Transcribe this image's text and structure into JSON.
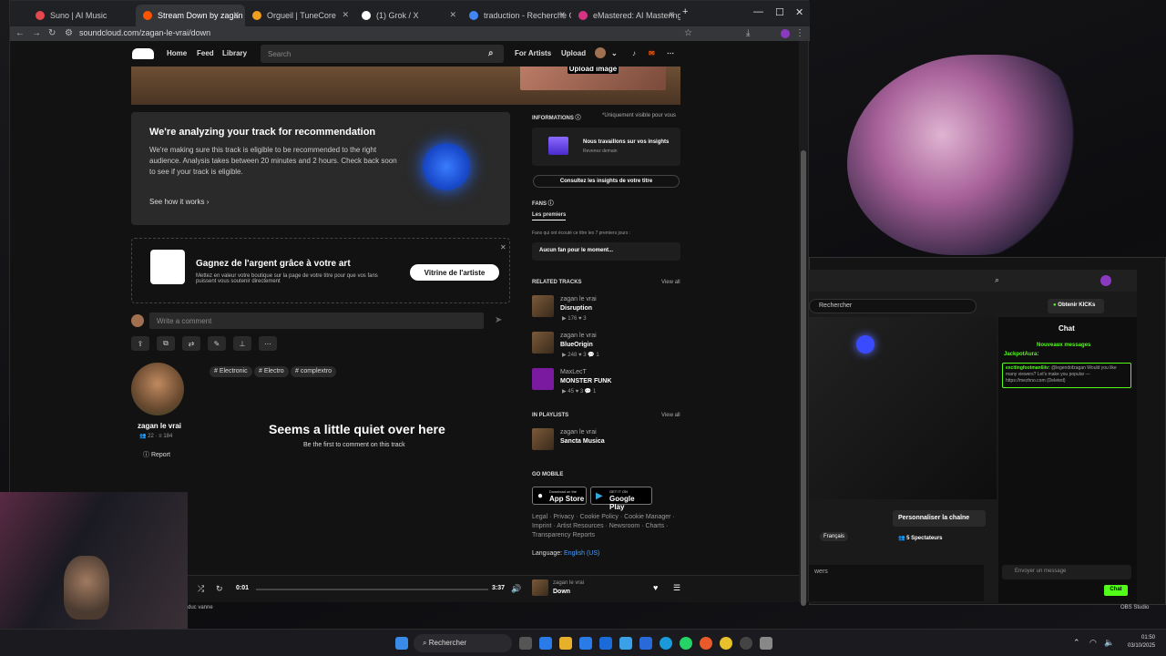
{
  "tabs": [
    {
      "label": "Suno | AI Music",
      "color": "#e5484d"
    },
    {
      "label": "Stream Down by zagan le vrai",
      "color": "#ff5500",
      "active": true
    },
    {
      "label": "Orgueil | TuneCore",
      "color": "#f0a020"
    },
    {
      "label": "(1) Grok / X",
      "color": "#ffffff"
    },
    {
      "label": "traduction - Recherche Google",
      "color": "#4285f4"
    },
    {
      "label": "eMastered: AI Mastering & Onl",
      "color": "#d63384"
    }
  ],
  "address": "soundcloud.com/zagan-le-vrai/down",
  "nav": {
    "home": "Home",
    "feed": "Feed",
    "library": "Library",
    "search_placeholder": "Search",
    "for_artists": "For Artists",
    "upload": "Upload",
    "upload_image": "Upload image"
  },
  "analyze": {
    "title": "We're analyzing your track for recommendation",
    "body": "We're making sure this track is eligible to be recommended to the right audience. Analysis takes between 20 minutes and 2 hours. Check back soon to see if your track is eligible.",
    "link": "See how it works"
  },
  "promo": {
    "title": "Gagnez de l'argent grâce à votre art",
    "body": "Mettez en valeur votre boutique sur la page de votre titre pour que vos fans puissent vous soutenir directement",
    "button": "Vitrine de l'artiste"
  },
  "comment_placeholder": "Write a comment",
  "tags": [
    "# Electronic",
    "# Electro",
    "# complextro"
  ],
  "artist": {
    "name": "zagan le vrai",
    "followers": "22",
    "tracks": "184",
    "report": "Report"
  },
  "empty": {
    "title": "Seems a little quiet over here",
    "sub": "Be the first to comment on this track"
  },
  "info": {
    "heading": "INFORMATIONS",
    "note": "*Uniquement visible pour vous",
    "insight_title": "Nous travaillons sur vos insights",
    "insight_sub": "Revenez demain",
    "insight_btn": "Consultez les insights de votre titre",
    "fans": "FANS",
    "fans_tab": "Les premiers",
    "fans_desc": "Fans qui ont écouté ce titre les 7 premiers jours :",
    "fans_empty": "Aucun fan pour le moment..."
  },
  "related": {
    "heading": "RELATED TRACKS",
    "view_all": "View all",
    "items": [
      {
        "artist": "zagan le vrai",
        "title": "Disruption",
        "stats": "▶ 176  ♥ 3"
      },
      {
        "artist": "zagan le vrai",
        "title": "BlueOrigin",
        "stats": "▶ 248  ♥ 3  💬 1"
      },
      {
        "artist": "MaxLecT",
        "title": "MONSTER FUNK",
        "stats": "▶ 45  ♥ 3  💬 1"
      }
    ]
  },
  "playlists": {
    "heading": "IN PLAYLISTS",
    "view_all": "View all",
    "artist": "zagan le vrai",
    "title": "Sancta Musica"
  },
  "mobile": {
    "heading": "GO MOBILE",
    "appstore": "App Store",
    "appstore_small": "Download on the",
    "gplay": "Google Play",
    "gplay_small": "GET IT ON"
  },
  "footer": {
    "links1": "Legal · Privacy · Cookie Policy · Cookie Manager ·",
    "links2": "Imprint · Artist Resources · Newsroom · Charts ·",
    "links3": "Transparency Reports",
    "language_label": "Language:",
    "language": "English (US)"
  },
  "player": {
    "elapsed": "0:01",
    "duration": "3:37",
    "artist": "zagan le vrai",
    "title": "Down"
  },
  "kick": {
    "search": "Rechercher",
    "get_kicks": "Obtenir KICKs",
    "chat_title": "Chat",
    "new_messages": "Nouveaux messages",
    "user1": "JackpotAura:",
    "user2": "excitingfootman6iiv:",
    "message": "@legendofzagan Would you like many viewers? Let's make you popular — https://mezhno.com",
    "deleted": "(Deleted)",
    "customize": "Personnaliser la chaîne",
    "lang": "Français",
    "viewers": "5 Spectateurs",
    "send_placeholder": "Envoyer un message",
    "chat_btn": "Chat",
    "viewers_lbl": "wers"
  },
  "obs_label": "OBS Studio",
  "webcam_caption": "duc vanne",
  "taskbar": {
    "search": "Rechercher",
    "time": "01:50",
    "date": "03/10/2025"
  }
}
